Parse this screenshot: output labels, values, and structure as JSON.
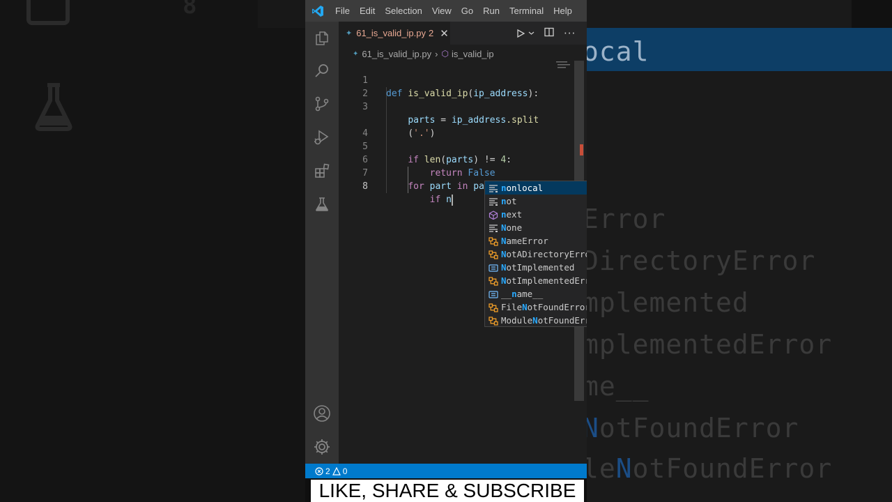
{
  "background": {
    "left_number": "8",
    "right_lines": [
      {
        "pre": "",
        "hl": "",
        "post": "ocal",
        "selected": true
      },
      {
        "pre": "",
        "hl": "",
        "post": "Error",
        "selected": false
      },
      {
        "pre": "",
        "hl": "",
        "post": "DirectoryError",
        "selected": false
      },
      {
        "pre": "",
        "hl": "",
        "post": "mplemented",
        "selected": false
      },
      {
        "pre": "",
        "hl": "",
        "post": "mplementedError",
        "selected": false
      },
      {
        "pre": "",
        "hl": "",
        "post": "me__",
        "selected": false
      },
      {
        "pre": "",
        "hl": "N",
        "post": "otFoundError",
        "selected": false
      },
      {
        "pre": "le",
        "hl": "N",
        "post": "otFoundError",
        "selected": false
      }
    ]
  },
  "menu": [
    "File",
    "Edit",
    "Selection",
    "View",
    "Go",
    "Run",
    "Terminal",
    "Help"
  ],
  "tab": {
    "filename": "61_is_valid_ip.py",
    "problems_badge": "2",
    "icon": "python-file-icon"
  },
  "breadcrumb": {
    "file": "61_is_valid_ip.py",
    "symbol": "is_valid_ip"
  },
  "editor": {
    "line_numbers": [
      "1",
      "2",
      "3",
      "",
      "4",
      "5",
      "6",
      "7",
      "8"
    ],
    "active_line": "8",
    "code": {
      "l1_kw": "def",
      "l1_fn": "is_valid_ip",
      "l1_param": "ip_address",
      "l1_tail": "):",
      "l3_var": "parts",
      "l3_eq": " = ",
      "l3_obj": "ip_address",
      "l3_method": ".split",
      "l3b_open": "(",
      "l3b_str": "'.'",
      "l3b_close": ")",
      "l5_kw": "if",
      "l5_fn": "len",
      "l5_arg": "parts",
      "l5_op": ") != ",
      "l5_num": "4",
      "l5_tail": ":",
      "l6_kw": "return",
      "l6_val": "False",
      "l7_kw": "for",
      "l7_var": "part",
      "l7_in": "in",
      "l7_iter": "parts",
      "l7_tail": ":",
      "l8_kw": "if",
      "l8_typed": "n"
    }
  },
  "suggestions": [
    {
      "icon": "keyword-icon",
      "match": "n",
      "rest": "onlocal",
      "prefix": "",
      "selected": true
    },
    {
      "icon": "keyword-icon",
      "match": "n",
      "rest": "ot",
      "prefix": "",
      "selected": false
    },
    {
      "icon": "method-cube-icon",
      "match": "n",
      "rest": "ext",
      "prefix": "",
      "selected": false
    },
    {
      "icon": "keyword-icon",
      "match": "N",
      "rest": "one",
      "prefix": "",
      "selected": false
    },
    {
      "icon": "class-icon",
      "match": "N",
      "rest": "ameError",
      "prefix": "",
      "selected": false
    },
    {
      "icon": "class-icon",
      "match": "N",
      "rest": "otADirectoryError",
      "prefix": "",
      "selected": false
    },
    {
      "icon": "variable-icon",
      "match": "N",
      "rest": "otImplemented",
      "prefix": "",
      "selected": false
    },
    {
      "icon": "class-icon",
      "match": "N",
      "rest": "otImplementedError",
      "prefix": "",
      "selected": false
    },
    {
      "icon": "variable-icon",
      "match": "n",
      "rest": "ame__",
      "prefix": "__",
      "selected": false
    },
    {
      "icon": "class-icon",
      "match": "N",
      "rest": "otFoundError",
      "prefix": "File",
      "selected": false
    },
    {
      "icon": "class-icon",
      "match": "N",
      "rest": "otFoundError",
      "prefix": "Module",
      "selected": false
    }
  ],
  "status": {
    "errors": "2",
    "warnings": "0"
  },
  "banner": "LIKE, SHARE & SUBSCRIBE",
  "colors": {
    "accent": "#007acc",
    "selection": "#04395e",
    "match": "#2aaaff",
    "tab_text": "#e8a892"
  }
}
